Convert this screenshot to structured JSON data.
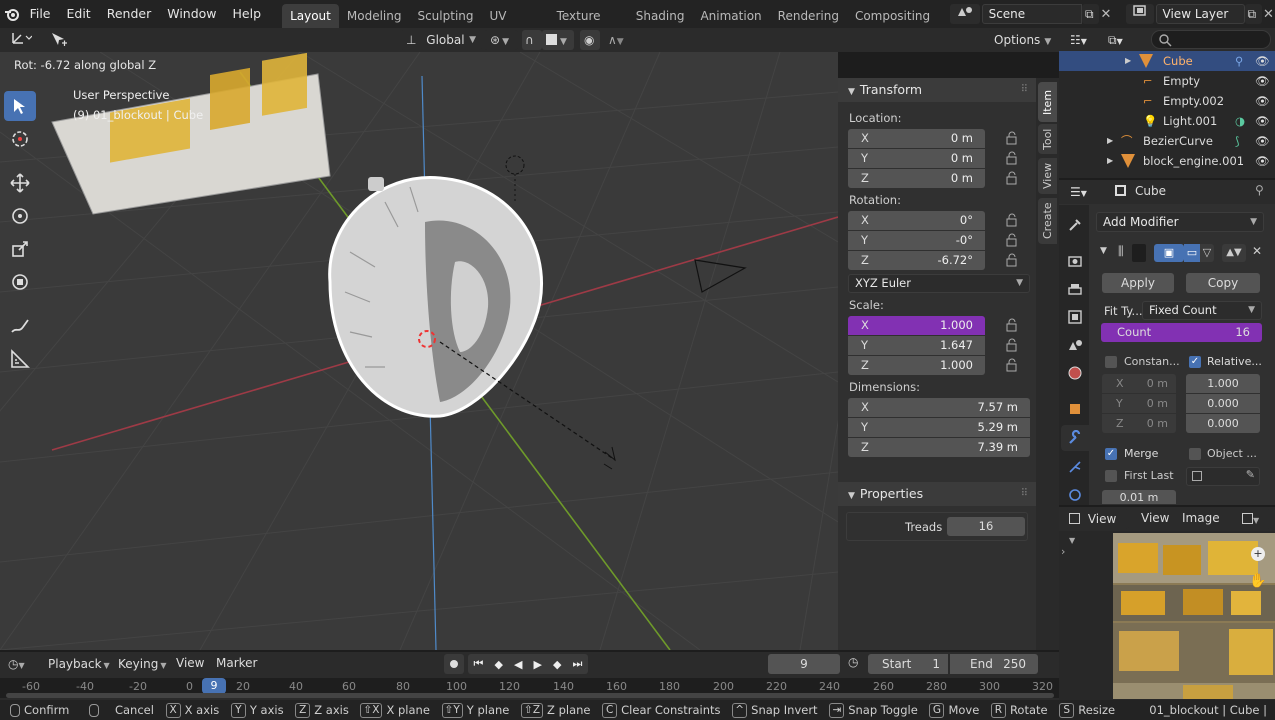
{
  "menu": {
    "items": [
      "File",
      "Edit",
      "Render",
      "Window",
      "Help"
    ]
  },
  "workspaces": {
    "tabs": [
      "Layout",
      "Modeling",
      "Sculpting",
      "UV Editing",
      "Texture Paint",
      "Shading",
      "Animation",
      "Rendering",
      "Compositing"
    ],
    "active": "Layout"
  },
  "scene": {
    "name": "Scene",
    "view_layer": "View Layer"
  },
  "viewport": {
    "orientation": "Global",
    "options_label": "Options",
    "operator_info": "Rot: -6.72 along global Z",
    "view_name": "User Perspective",
    "object_info": "(9) 01_blockout | Cube"
  },
  "npanel": {
    "tabs": [
      "Item",
      "Tool",
      "View",
      "Create"
    ],
    "transform_title": "Transform",
    "location_label": "Location:",
    "location": [
      {
        "axis": "X",
        "value": "0 m"
      },
      {
        "axis": "Y",
        "value": "0 m"
      },
      {
        "axis": "Z",
        "value": "0 m"
      }
    ],
    "rotation_label": "Rotation:",
    "rotation": [
      {
        "axis": "X",
        "value": "0°"
      },
      {
        "axis": "Y",
        "value": "-0°"
      },
      {
        "axis": "Z",
        "value": "-6.72°"
      }
    ],
    "rotation_mode": "XYZ Euler",
    "scale_label": "Scale:",
    "scale": [
      {
        "axis": "X",
        "value": "1.000"
      },
      {
        "axis": "Y",
        "value": "1.647"
      },
      {
        "axis": "Z",
        "value": "1.000"
      }
    ],
    "dimensions_label": "Dimensions:",
    "dimensions": [
      {
        "axis": "X",
        "value": "7.57 m"
      },
      {
        "axis": "Y",
        "value": "5.29 m"
      },
      {
        "axis": "Z",
        "value": "7.39 m"
      }
    ],
    "properties_title": "Properties",
    "treads_label": "Treads",
    "treads_value": "16"
  },
  "outliner": {
    "items": [
      "Cube",
      "Empty",
      "Empty.002",
      "Light.001",
      "BezierCurve",
      "block_engine.001"
    ]
  },
  "properties": {
    "object_name": "Cube",
    "add_modifier": "Add Modifier",
    "apply": "Apply",
    "copy": "Copy",
    "fit_type_label": "Fit Ty...",
    "fit_type_value": "Fixed Count",
    "count_label": "Count",
    "count_value": "16",
    "constant_label": "Constan...",
    "relative_label": "Relative...",
    "constant_offsets": [
      {
        "axis": "X",
        "value": "0 m"
      },
      {
        "axis": "Y",
        "value": "0 m"
      },
      {
        "axis": "Z",
        "value": "0 m"
      }
    ],
    "relative_offsets": [
      "1.000",
      "0.000",
      "0.000"
    ],
    "merge_label": "Merge",
    "object_label": "Object ...",
    "first_last_label": "First Last",
    "distance_value": "0.01 m"
  },
  "image_editor": {
    "view_menu": "View",
    "menus": [
      "View",
      "Image"
    ]
  },
  "timeline": {
    "menus": [
      "Playback",
      "Keying",
      "View",
      "Marker"
    ],
    "current_frame": "9",
    "start_label": "Start",
    "start_value": "1",
    "end_label": "End",
    "end_value": "250",
    "ruler": [
      "-60",
      "-40",
      "-20",
      "0",
      "9",
      "20",
      "40",
      "60",
      "80",
      "100",
      "120",
      "140",
      "160",
      "180",
      "200",
      "220",
      "240",
      "260",
      "280",
      "300",
      "320"
    ]
  },
  "status": {
    "items": [
      {
        "key": "",
        "label": "Confirm"
      },
      {
        "key": "",
        "label": "Cancel"
      },
      {
        "key": "X",
        "label": "X axis"
      },
      {
        "key": "Y",
        "label": "Y axis"
      },
      {
        "key": "Z",
        "label": "Z axis"
      },
      {
        "key": "⇧X",
        "label": "X plane"
      },
      {
        "key": "⇧Y",
        "label": "Y plane"
      },
      {
        "key": "⇧Z",
        "label": "Z plane"
      },
      {
        "key": "C",
        "label": "Clear Constraints"
      },
      {
        "key": "^",
        "label": "Snap Invert"
      },
      {
        "key": "⇥",
        "label": "Snap Toggle"
      },
      {
        "key": "G",
        "label": "Move"
      },
      {
        "key": "R",
        "label": "Rotate"
      },
      {
        "key": "S",
        "label": "Resize"
      }
    ],
    "right_info": "01_blockout | Cube |"
  }
}
